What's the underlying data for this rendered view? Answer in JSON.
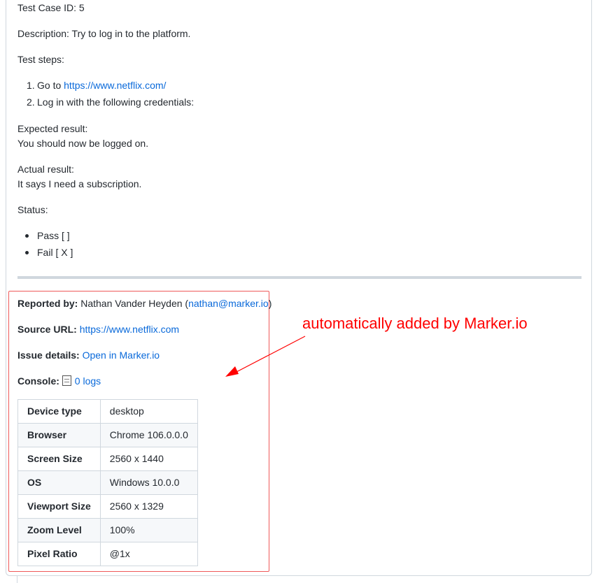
{
  "test_case_id": "Test Case ID: 5",
  "description": "Description: Try to log in to the platform.",
  "steps_heading": "Test steps:",
  "steps": [
    {
      "number": "1.",
      "text": "Go to ",
      "link": "https://www.netflix.com/"
    },
    {
      "number": "2.",
      "text": "Log in with the following credentials:"
    }
  ],
  "expected": {
    "label": "Expected result:",
    "text": "You should now be logged on."
  },
  "actual": {
    "label": "Actual result:",
    "text": "It says I need a subscription."
  },
  "status": {
    "label": "Status:",
    "items": [
      "Pass [ ]",
      "Fail [ X ]"
    ]
  },
  "reported_by": {
    "label": "Reported by:",
    "name": " Nathan Vander Heyden (",
    "email": "nathan@marker.io",
    "close": ")"
  },
  "source_url": {
    "label": "Source URL:",
    "link": "https://www.netflix.com"
  },
  "issue_details": {
    "label": "Issue details:",
    "link": "Open in Marker.io"
  },
  "console": {
    "label": "Console:",
    "link": "0 logs"
  },
  "info_table": [
    {
      "key": "Device type",
      "value": "desktop"
    },
    {
      "key": "Browser",
      "value": "Chrome 106.0.0.0"
    },
    {
      "key": "Screen Size",
      "value": "2560 x 1440"
    },
    {
      "key": "OS",
      "value": "Windows 10.0.0"
    },
    {
      "key": "Viewport Size",
      "value": "2560 x 1329"
    },
    {
      "key": "Zoom Level",
      "value": "100%"
    },
    {
      "key": "Pixel Ratio",
      "value": "@1x"
    }
  ],
  "annotation": {
    "text": "automatically added by Marker.io",
    "color": "#ff0000"
  },
  "colors": {
    "link": "#0969da",
    "highlight_border": "#ef5a5a",
    "border": "#d0d7de"
  }
}
